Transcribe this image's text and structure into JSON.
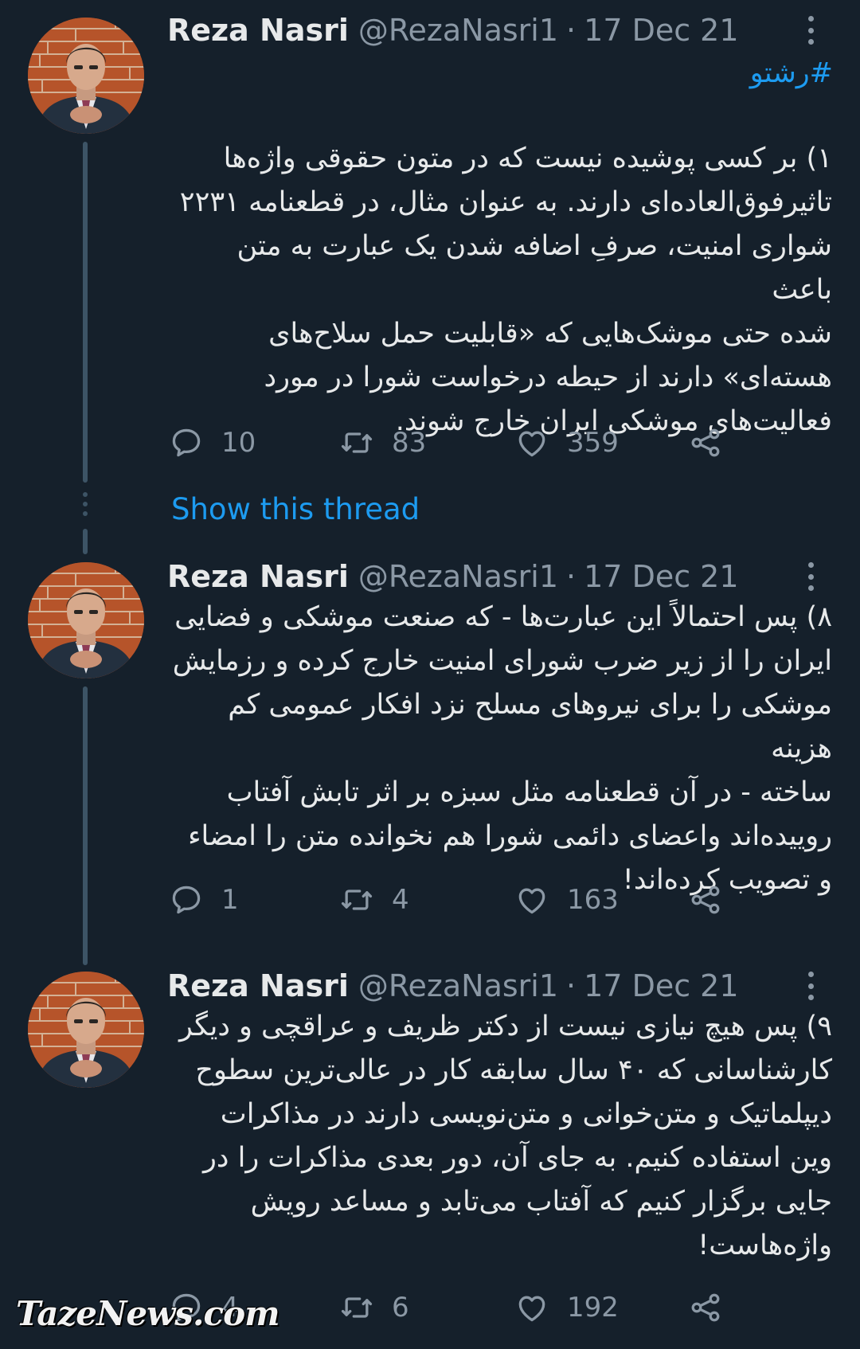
{
  "tweets": [
    {
      "name": "Reza Nasri",
      "handle": "@RezaNasri1",
      "date": "17 Dec 21",
      "hashtag": "#رشتو",
      "text": "۱) بر کسی پوشیده نیست که در متون حقوقی واژه‌ها\nتاثیرفوق‌العاده‌ای دارند. به عنوان مثال، در قطعنامه ۲۲۳۱\nشواری امنیت، صرفِ اضافه شدن یک عبارت به متن باعث\nشده حتی موشک‌هایی که «قابلیت حمل سلاح‌های\nهسته‌ای» دارند از حیطه درخواست شورا در مورد\nفعالیت‌های موشکی ایران خارج شوند.",
      "replies": "10",
      "retweets": "83",
      "likes": "359"
    },
    {
      "name": "Reza Nasri",
      "handle": "@RezaNasri1",
      "date": "17 Dec 21",
      "text": "۸) پس احتمالاً این عبارت‌ها - که صنعت موشکی و فضایی\nایران را از زیر ضرب شورای امنیت خارج کرده و رزمایش\nموشکی را برای نیروهای مسلح نزد افکار عمومی کم هزینه\nساخته - در آن قطعنامه مثل سبزه بر اثر تابش آفتاب\nروییده‌اند واعضای دائمی شورا هم نخوانده متن را امضاء\nو تصویب کرده‌اند!",
      "replies": "1",
      "retweets": "4",
      "likes": "163"
    },
    {
      "name": "Reza Nasri",
      "handle": "@RezaNasri1",
      "date": "17 Dec 21",
      "text": "۹) پس هیچ نیازی نیست از دکتر ظریف و عراقچی و دیگر\nکارشناسانی که ۴۰ سال سابقه کار در عالی‌ترین سطوح\nدیپلماتیک و متن‌خوانی و متن‌نویسی دارند در مذاکرات\nوین استفاده کنیم. به جای آن، دور بعدی مذاکرات را در\nجایی برگزار کنیم که آفتاب می‌تابد و مساعد رویش\nواژه‌هاست!",
      "replies": "4",
      "retweets": "6",
      "likes": "192"
    }
  ],
  "show_thread_label": "Show this thread",
  "watermark": "TazeNews.com",
  "colors": {
    "background": "#15202b",
    "accent": "#1d9bf0",
    "muted": "#8b98a5",
    "text": "#e7e9ea"
  },
  "icons": [
    "reply-icon",
    "retweet-icon",
    "like-icon",
    "share-icon",
    "more-icon"
  ]
}
